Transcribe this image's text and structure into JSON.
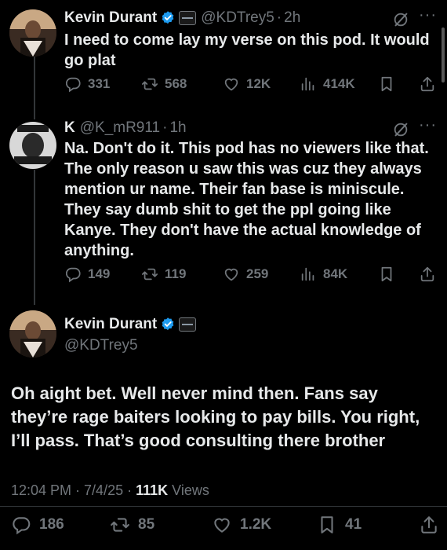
{
  "tweet1": {
    "name": "Kevin Durant",
    "handle": "@KDTrey5",
    "separator": "·",
    "time": "2h",
    "text": "I need to come lay my verse on this pod. It would go plat",
    "replies": "331",
    "retweets": "568",
    "likes": "12K",
    "views": "414K"
  },
  "tweet2": {
    "name": "K",
    "handle": "@K_mR911",
    "separator": "·",
    "time": "1h",
    "text": "Na. Don't do it. This pod has no viewers like that. The only reason u saw this was cuz they always mention ur name. Their fan base is miniscule. They say dumb shit to get the ppl going like Kanye. They don't have the actual knowledge of anything.",
    "replies": "149",
    "retweets": "119",
    "likes": "259",
    "views": "84K"
  },
  "main": {
    "name": "Kevin Durant",
    "handle": "@KDTrey5",
    "text": "Oh aight bet. Well never mind then. Fans say they’re rage baiters looking to pay bills. You right, I’ll pass. That’s good consulting there brother",
    "time": "12:04 PM",
    "date": "7/4/25",
    "views_count": "111K",
    "views_label": "Views",
    "replies": "186",
    "retweets": "85",
    "likes": "1.2K",
    "bookmarks": "41"
  },
  "icons": {
    "more": "more-icon",
    "verified": "verified-badge-icon",
    "grok": "grok-icon",
    "reply": "reply-icon",
    "retweet": "retweet-icon",
    "like": "heart-icon",
    "views": "views-icon",
    "bookmark": "bookmark-icon",
    "share": "share-icon"
  },
  "colors": {
    "background": "#000000",
    "text": "#e7e9ea",
    "muted": "#71767b",
    "verified": "#1d9bf0"
  }
}
